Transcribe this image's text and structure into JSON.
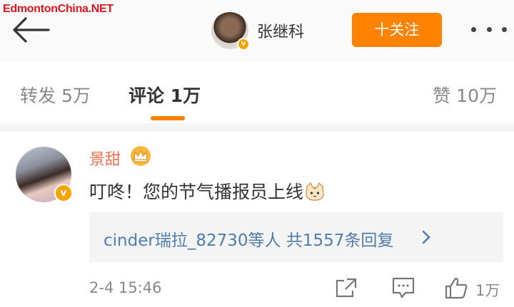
{
  "watermark": "EdmontonChina.NET",
  "header": {
    "username": "张继科",
    "follow_label": "十关注",
    "back_icon": "back-arrow-icon",
    "more_icon": "more-dots-icon"
  },
  "tabs": {
    "repost_label": "转发 5万",
    "comment_label": "评论 1万",
    "like_label": "赞 10万",
    "active_color": "#ff8200"
  },
  "comment": {
    "author": "景甜",
    "text": "叮咚！您的节气播报员上线",
    "reply_users": "cinder瑞拉_82730等人",
    "reply_summary": "共1557条回复",
    "time": "2-4 15:46",
    "like_count": "1万",
    "author_color": "#eb7350",
    "link_color": "#507daf"
  },
  "colors": {
    "accent": "#ff8200",
    "verified": "#f7a400",
    "watermark": "#e0141e"
  }
}
